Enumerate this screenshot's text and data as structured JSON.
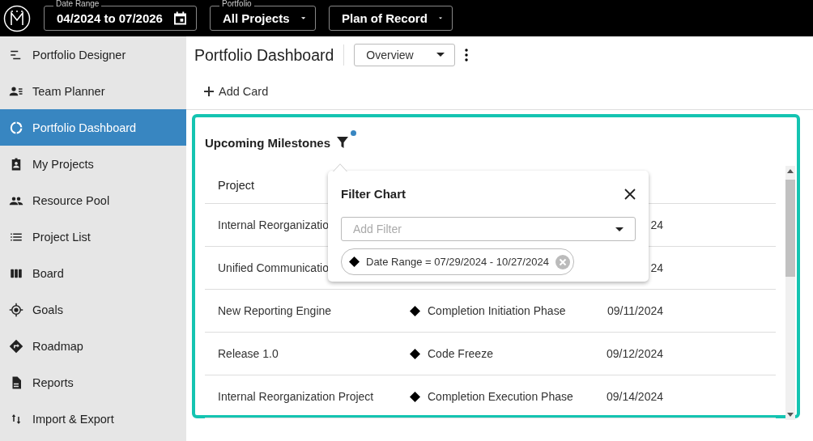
{
  "topbar": {
    "date_range": {
      "label": "Date Range",
      "value": "04/2024 to 07/2026"
    },
    "portfolio": {
      "label": "Portfolio",
      "value": "All Projects"
    },
    "plan": {
      "value": "Plan of Record"
    }
  },
  "sidebar": {
    "items": [
      {
        "label": "Portfolio Designer",
        "selected": false
      },
      {
        "label": "Team Planner",
        "selected": false
      },
      {
        "label": "Portfolio Dashboard",
        "selected": true
      },
      {
        "label": "My Projects",
        "selected": false
      },
      {
        "label": "Resource Pool",
        "selected": false
      },
      {
        "label": "Project List",
        "selected": false
      },
      {
        "label": "Board",
        "selected": false
      },
      {
        "label": "Goals",
        "selected": false
      },
      {
        "label": "Roadmap",
        "selected": false
      },
      {
        "label": "Reports",
        "selected": false
      },
      {
        "label": "Import & Export",
        "selected": false
      }
    ]
  },
  "header": {
    "title": "Portfolio Dashboard",
    "view": "Overview",
    "add_card": "Add Card"
  },
  "card": {
    "title": "Upcoming Milestones",
    "filter_active": true,
    "table": {
      "columns": [
        "Project"
      ],
      "rows": [
        {
          "project": "Internal Reorganizatio",
          "date": "24"
        },
        {
          "project": "Unified Communicatio",
          "date": "24"
        },
        {
          "project": "New Reporting Engine",
          "milestone": "Completion Initiation Phase",
          "date": "09/11/2024"
        },
        {
          "project": "Release 1.0",
          "milestone": "Code Freeze",
          "date": "09/12/2024"
        },
        {
          "project": "Internal Reorganization Project",
          "milestone": "Completion Execution Phase",
          "date": "09/14/2024"
        }
      ]
    }
  },
  "filter_popup": {
    "title": "Filter Chart",
    "placeholder": "Add Filter",
    "chips": [
      "Date Range = 07/29/2024 - 10/27/2024"
    ]
  }
}
